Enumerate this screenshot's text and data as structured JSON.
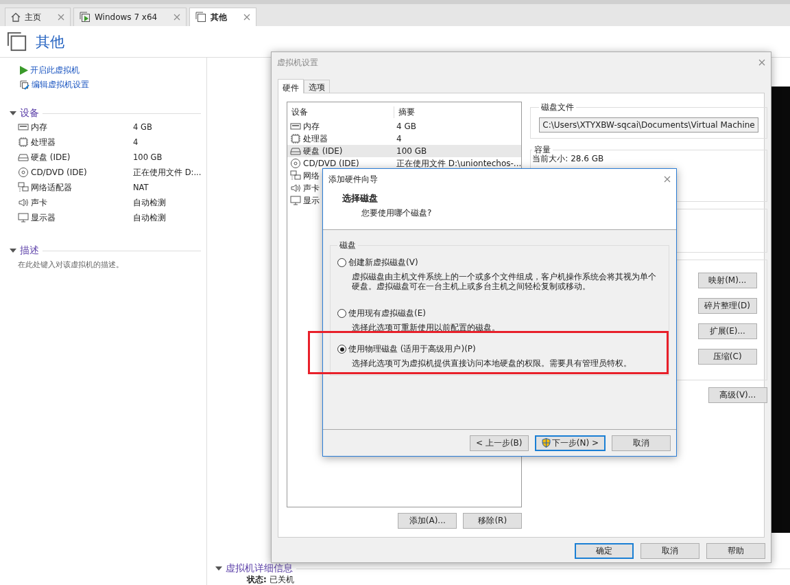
{
  "tabs": [
    {
      "label": "主页",
      "kind": "home",
      "selected": false
    },
    {
      "label": "Windows 7 x64",
      "kind": "vm",
      "selected": false
    },
    {
      "label": "其他",
      "kind": "other",
      "selected": true
    }
  ],
  "page": {
    "title": "其他",
    "actions": [
      {
        "label": "开启此虚拟机",
        "kind": "power-on"
      },
      {
        "label": "编辑虚拟机设置",
        "kind": "edit"
      }
    ],
    "devices_title": "设备",
    "devices": [
      {
        "kind": "memory",
        "name": "内存",
        "summary": "4 GB"
      },
      {
        "kind": "cpu",
        "name": "处理器",
        "summary": "4"
      },
      {
        "kind": "disk",
        "name": "硬盘 (IDE)",
        "summary": "100 GB"
      },
      {
        "kind": "cdrom",
        "name": "CD/DVD (IDE)",
        "summary": "正在使用文件 D:..."
      },
      {
        "kind": "network",
        "name": "网络适配器",
        "summary": "NAT"
      },
      {
        "kind": "sound",
        "name": "声卡",
        "summary": "自动检测"
      },
      {
        "kind": "display",
        "name": "显示器",
        "summary": "自动检测"
      }
    ],
    "description_title": "描述",
    "description_placeholder": "在此处键入对该虚拟机的描述。",
    "details_title": "虚拟机详细信息",
    "status": "**状态:** 已关机"
  },
  "settings_dialog": {
    "title": "虚拟机设置",
    "tabs": [
      {
        "label": "硬件",
        "selected": true
      },
      {
        "label": "选项",
        "selected": false
      }
    ],
    "columns": [
      "设备",
      "摘要"
    ],
    "devices": [
      {
        "kind": "memory",
        "name": "内存",
        "summary": "4 GB",
        "selected": false
      },
      {
        "kind": "cpu",
        "name": "处理器",
        "summary": "4",
        "selected": false
      },
      {
        "kind": "disk",
        "name": "硬盘 (IDE)",
        "summary": "100 GB",
        "selected": true
      },
      {
        "kind": "cdrom",
        "name": "CD/DVD (IDE)",
        "summary": "正在使用文件 D:\\uniontechos-...",
        "selected": false
      },
      {
        "kind": "network",
        "name": "网络",
        "selected": false
      },
      {
        "kind": "sound",
        "name": "声卡",
        "selected": false
      },
      {
        "kind": "display",
        "name": "显示",
        "selected": false
      }
    ],
    "list_buttons": [
      "添加(A)...",
      "移除(R)"
    ],
    "disk_file": {
      "title": "磁盘文件",
      "value": "C:\\Users\\XTYXBW-sqcai\\Documents\\Virtual Machine"
    },
    "capacity": {
      "title": "容量",
      "current_size": "当前大小: 28.6 GB"
    },
    "disk_buttons": [
      "映射(M)...",
      "碎片整理(D)",
      "扩展(E)...",
      "压缩(C)"
    ],
    "advanced_button": "高级(V)...",
    "buttons": [
      {
        "label": "确定",
        "default": true
      },
      {
        "label": "取消",
        "default": false
      },
      {
        "label": "帮助",
        "default": false
      }
    ]
  },
  "wizard": {
    "title": "添加硬件向导",
    "heading": "选择磁盘",
    "subheading": "您要使用哪个磁盘?",
    "group_title": "磁盘",
    "options": [
      {
        "label": "创建新虚拟磁盘(V)",
        "description": "虚拟磁盘由主机文件系统上的一个或多个文件组成，客户机操作系统会将其视为单个硬盘。虚拟磁盘可在一台主机上或多台主机之间轻松复制或移动。",
        "selected": false
      },
      {
        "label": "使用现有虚拟磁盘(E)",
        "description": "选择此选项可重新使用以前配置的磁盘。",
        "selected": false
      },
      {
        "label": "使用物理磁盘 (适用于高级用户)(P)",
        "description": "选择此选项可为虚拟机提供直接访问本地硬盘的权限。需要具有管理员特权。",
        "selected": true
      }
    ],
    "buttons": [
      {
        "label": "< 上一步(B)",
        "kind": "back",
        "default": false
      },
      {
        "label": "下一步(N) >",
        "kind": "next",
        "default": true
      },
      {
        "label": "取消",
        "kind": "cancel",
        "default": false
      }
    ]
  }
}
